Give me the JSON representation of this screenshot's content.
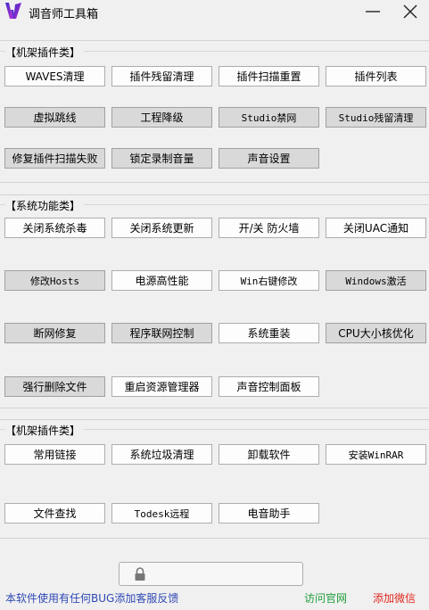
{
  "window": {
    "title": "调音师工具箱",
    "icons": {
      "logo": "app-logo-icon",
      "minimize": "minimize-icon",
      "close": "close-icon"
    }
  },
  "groups": [
    {
      "title": "【机架插件类】",
      "buttons": [
        "WAVES清理",
        "插件残留清理",
        "插件扫描重置",
        "插件列表",
        "虚拟跳线",
        "工程降级",
        "Studio禁网",
        "Studio残留清理",
        "修复插件扫描失败",
        "锁定录制音量",
        "声音设置"
      ]
    },
    {
      "title": "【系统功能类】",
      "buttons": [
        "关闭系统杀毒",
        "关闭系统更新",
        "开/关 防火墙",
        "关闭UAC通知",
        "修改Hosts",
        "电源高性能",
        "Win右键修改",
        "Windows激活",
        "断网修复",
        "程序联网控制",
        "系统重装",
        "CPU大小核优化",
        "强行删除文件",
        "重启资源管理器",
        "声音控制面板"
      ]
    },
    {
      "title": "【机架插件类】",
      "buttons": [
        "常用链接",
        "系统垃圾清理",
        "卸载软件",
        "安装WinRAR",
        "文件查找",
        "Todesk远程",
        "电音助手"
      ]
    }
  ],
  "lock_field": {
    "icon": "lock-icon"
  },
  "footer": {
    "feedback": "本软件使用有任何BUG添加客服反馈",
    "website": "访问官网",
    "wechat": "添加微信",
    "colors": {
      "feedback": "#2f49b5",
      "website": "#1e9d3a",
      "wechat": "#e0261f"
    }
  }
}
